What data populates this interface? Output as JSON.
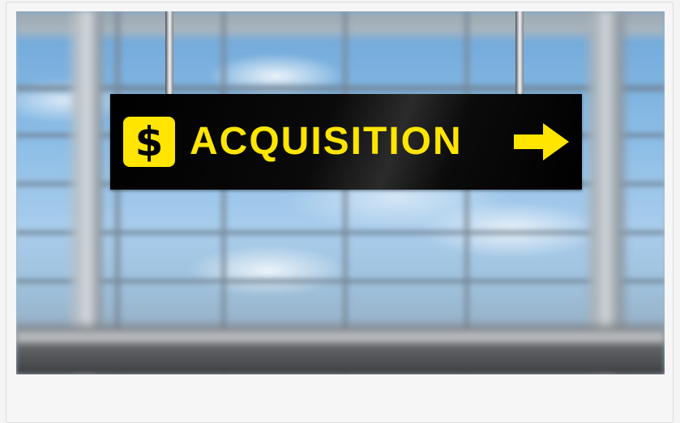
{
  "sign": {
    "symbol": "$",
    "text": "ACQUISITION",
    "arrow_icon": "right-arrow-icon"
  },
  "colors": {
    "sign_background": "#000000",
    "sign_text": "#ffe500",
    "page_background": "#f4f4f4"
  }
}
